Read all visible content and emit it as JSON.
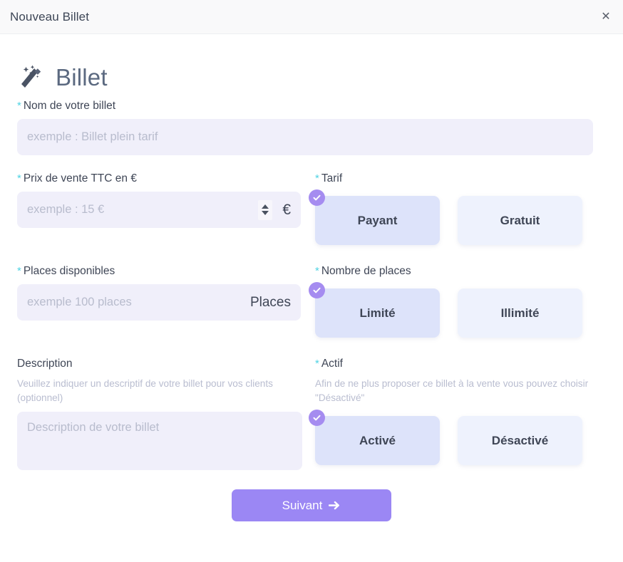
{
  "header": {
    "title": "Nouveau Billet",
    "close_label": "✕"
  },
  "wizard": {
    "title": "Billet",
    "icon": "magic-wand-icon"
  },
  "colors": {
    "accent_purple": "#9b87f4",
    "badge_purple": "#a58cf0",
    "required_asterisk": "#4fd3e3",
    "input_bg": "#f0effa",
    "tile_bg": "#eef2fd",
    "tile_selected_bg": "#dde3fa",
    "header_bg": "#f9f9fa"
  },
  "fields": {
    "name": {
      "required_mark": "*",
      "label": "Nom de votre billet",
      "placeholder": "exemple : Billet plein tarif",
      "value": ""
    },
    "price": {
      "required_mark": "*",
      "label": "Prix de vente TTC en €",
      "placeholder": "exemple : 15 €",
      "value": "",
      "suffix": "€"
    },
    "seats": {
      "required_mark": "*",
      "label": "Places disponibles",
      "placeholder": "exemple 100 places",
      "value": "",
      "suffix": "Places"
    },
    "description": {
      "label": "Description",
      "hint": "Veuillez indiquer un descriptif de votre billet pour vos clients (optionnel)",
      "placeholder": "Description de votre billet",
      "value": ""
    }
  },
  "choices": {
    "tarif": {
      "required_mark": "*",
      "label": "Tarif",
      "options": [
        {
          "label": "Payant",
          "selected": true
        },
        {
          "label": "Gratuit",
          "selected": false
        }
      ]
    },
    "nombre_places": {
      "required_mark": "*",
      "label": "Nombre de places",
      "options": [
        {
          "label": "Limité",
          "selected": true
        },
        {
          "label": "Illimité",
          "selected": false
        }
      ]
    },
    "actif": {
      "required_mark": "*",
      "label": "Actif",
      "hint": "Afin de ne plus proposer ce billet à la vente vous pouvez choisir \"Désactivé\"",
      "options": [
        {
          "label": "Activé",
          "selected": true
        },
        {
          "label": "Désactivé",
          "selected": false
        }
      ]
    }
  },
  "footer": {
    "submit_label": "Suivant"
  }
}
